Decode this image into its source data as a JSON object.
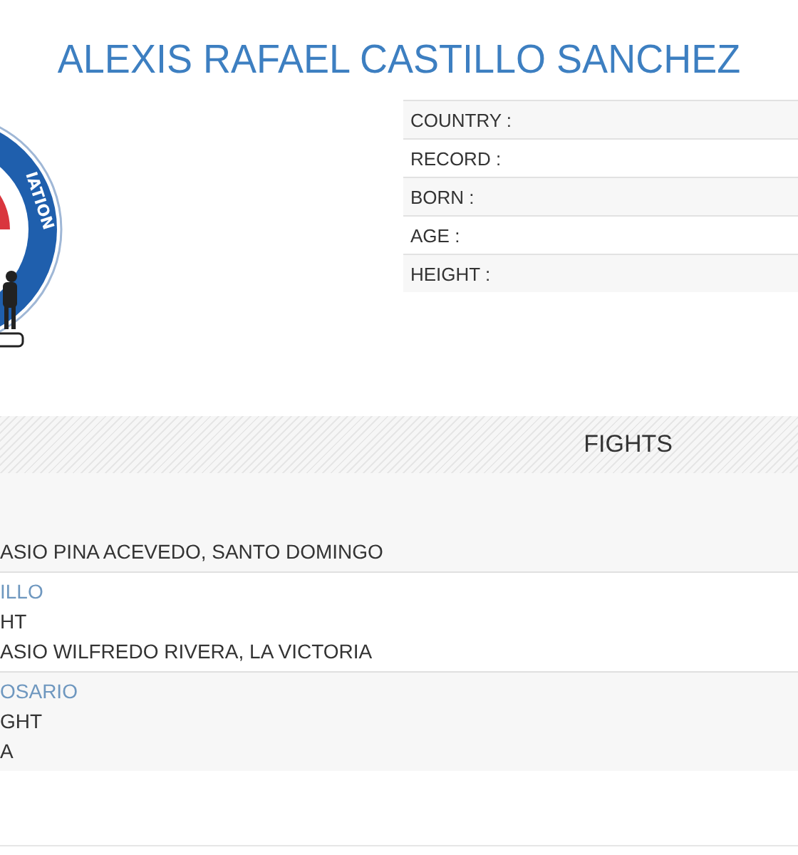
{
  "title": "ALEXIS RAFAEL CASTILLO SANCHEZ",
  "logo": {
    "text": "IATION"
  },
  "info": [
    {
      "label": "COUNTRY :"
    },
    {
      "label": "RECORD :"
    },
    {
      "label": "BORN :"
    },
    {
      "label": "AGE :"
    },
    {
      "label": "HEIGHT :"
    }
  ],
  "fights_heading": "FIGHTS",
  "fights": [
    {
      "venue": "ASIO PINA ACEVEDO, SANTO DOMINGO"
    },
    {
      "opponent": "ILLO",
      "division": "HT",
      "venue": "ASIO WILFREDO RIVERA, LA VICTORIA"
    },
    {
      "opponent": "OSARIO",
      "division": "GHT",
      "venue": "A"
    }
  ]
}
